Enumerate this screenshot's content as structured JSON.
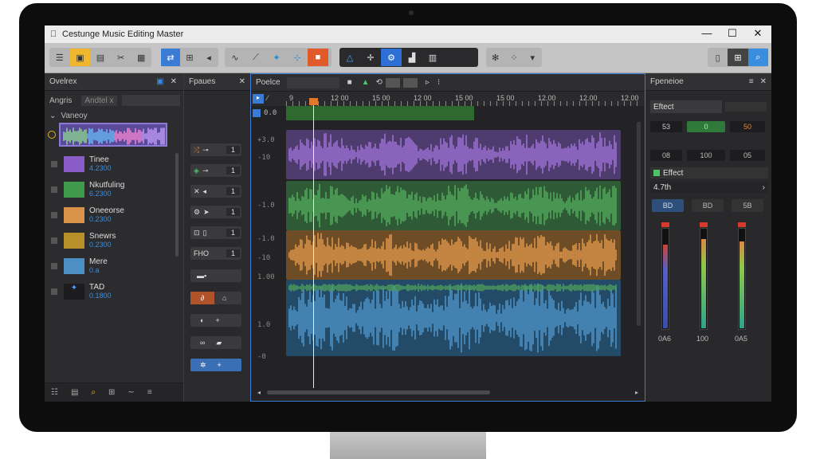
{
  "window": {
    "title": "Cestunge  Music Editing Master",
    "apple_icon": "apple-icon",
    "minimize": "—",
    "maximize": "☐",
    "close": "✕"
  },
  "colors": {
    "purple_track": "#9a6fd0",
    "green_track": "#4fa65a",
    "orange_track": "#d9924a",
    "blue_track": "#4b8fc4",
    "accent": "#2e6fd6"
  },
  "browser": {
    "tab": "Ovelrex",
    "filter_label": "Angris",
    "filter_chip": "Andtel x",
    "section": "Vaneoy",
    "items": [
      {
        "name": "Tinee",
        "value": "4.2300",
        "thumb": "purple"
      },
      {
        "name": "Nkutfuling",
        "value": "6.2300",
        "thumb": "green"
      },
      {
        "name": "Oneeorse",
        "value": "0.2300",
        "thumb": "orange"
      },
      {
        "name": "Snewrs",
        "value": "0.2300",
        "thumb": "gold"
      },
      {
        "name": "Mere",
        "value": "0.a",
        "thumb": "mixed"
      },
      {
        "name": "TAD",
        "value": "0.1800",
        "thumb": "spark"
      }
    ]
  },
  "tracks_panel": {
    "title": "Fpaues",
    "counts": [
      "1",
      "1",
      "1",
      "1",
      "1"
    ],
    "label_5": "FHO"
  },
  "editor": {
    "title": "Poelce",
    "position": "0.0",
    "ruler": [
      "9",
      "12 00",
      "15 00",
      "12 00",
      "15 00",
      "15 00",
      "12.00",
      "12.00",
      "12.00"
    ],
    "db_labels": [
      "+3.0",
      "-10",
      "-1.0",
      "-1.0",
      "-10",
      "1.00",
      "1.0",
      "-0"
    ]
  },
  "right_panel": {
    "title": "Fpeneioe",
    "effect_label": "Eftect",
    "values_row1": [
      "53",
      "0",
      "50"
    ],
    "values_row2": [
      "08",
      "100",
      "05"
    ],
    "effect2_label": "Effect",
    "effect2_value": "4.7th",
    "buttons": [
      "BD",
      "BD",
      "5B"
    ],
    "meter_labels": [
      "0A6",
      "100",
      "0A5"
    ],
    "meter_levels": [
      0.85,
      0.9,
      0.88
    ]
  }
}
